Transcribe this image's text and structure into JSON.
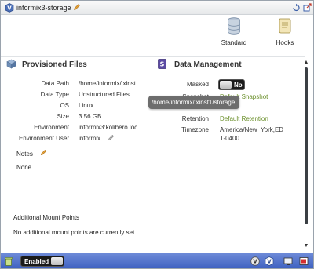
{
  "header": {
    "title": "informix3-storage",
    "logo_icon": "vdisk-logo-icon",
    "edit_icon": "pencil-icon",
    "right_icons": [
      "refresh-icon",
      "export-icon"
    ]
  },
  "tabs": [
    {
      "label": "Standard",
      "icon": "database-icon"
    },
    {
      "label": "Hooks",
      "icon": "scroll-icon"
    }
  ],
  "provisioned_files": {
    "title": "Provisioned Files",
    "rows": [
      {
        "key": "Data Path",
        "value": "/home/informix/lxinst..."
      },
      {
        "key": "Data Type",
        "value": "Unstructured Files"
      },
      {
        "key": "OS",
        "value": "Linux"
      },
      {
        "key": "Size",
        "value": "3.56 GB"
      },
      {
        "key": "Environment",
        "value": "informix3:kolibero.loc..."
      },
      {
        "key": "Environment User",
        "value": "informix"
      }
    ],
    "notes_label": "Notes",
    "notes_value": "None",
    "mount_points_label": "Additional Mount Points",
    "mount_points_value": "No additional mount points are currently set."
  },
  "data_management": {
    "title": "Data Management",
    "masked_label": "Masked",
    "masked_toggle": "No",
    "snapshot_label": "Snapshot",
    "snapshot_value": "Default Snapshot",
    "retention_label": "Retention",
    "retention_value": "Default Retention",
    "timezone_label": "Timezone",
    "timezone_value_line1": "America/New_York,ED",
    "timezone_value_line2": "T-0400"
  },
  "tooltip": "/home/informix/lxinst1/storage",
  "footer": {
    "enabled_toggle": "Enabled"
  },
  "colors": {
    "footer_blue": "#4a6ccb",
    "link_green": "#6a8f2a"
  }
}
